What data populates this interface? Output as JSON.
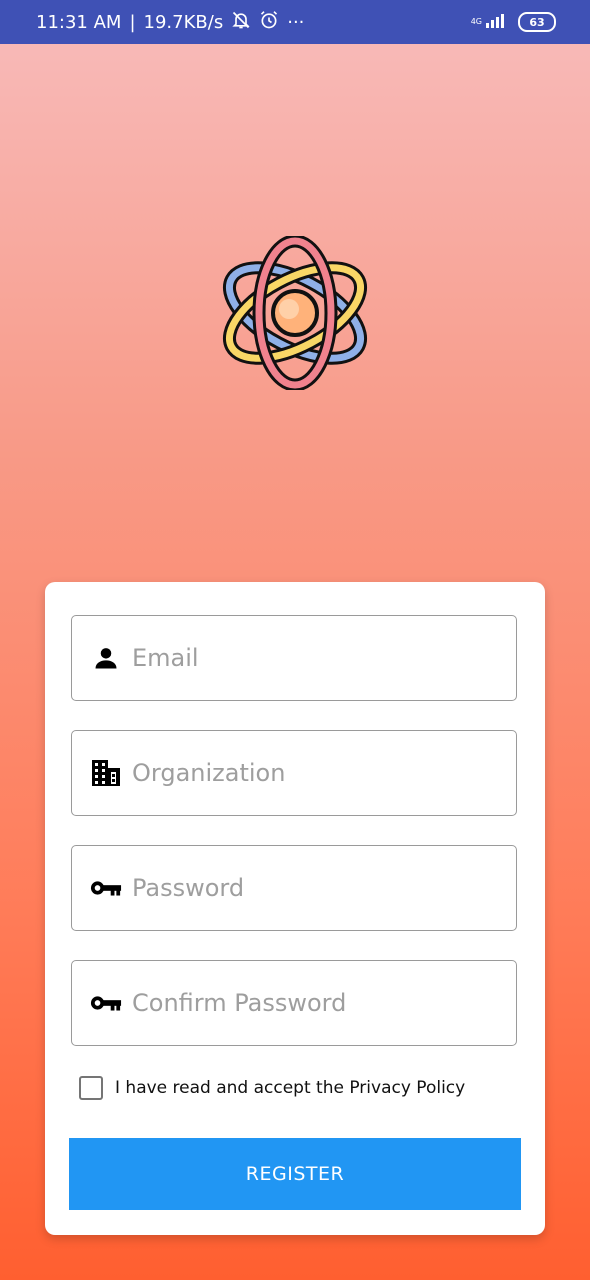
{
  "status_bar": {
    "time": "11:31 AM",
    "separator": "|",
    "speed": "19.7KB/s",
    "more": "···",
    "network": "4G",
    "battery": "63"
  },
  "logo": {
    "icon": "atom-icon",
    "colors": {
      "nucleus": "#ffb27a",
      "ring_pink": "#f0828e",
      "ring_blue": "#8fb0e8",
      "ring_yellow": "#f9d766"
    }
  },
  "form": {
    "email": {
      "placeholder": "Email",
      "icon": "person-icon"
    },
    "organization": {
      "placeholder": "Organization",
      "icon": "building-icon"
    },
    "password": {
      "placeholder": "Password",
      "icon": "key-icon"
    },
    "confirm_password": {
      "placeholder": "Confirm Password",
      "icon": "key-icon"
    },
    "privacy_label": "I have read and accept the Privacy Policy",
    "privacy_checked": false,
    "register_label": "REGISTER"
  },
  "colors": {
    "status_bar": "#3f51b5",
    "button": "#2196f3",
    "gradient_top": "#f8bcbc",
    "gradient_bottom": "#ff5f30"
  }
}
